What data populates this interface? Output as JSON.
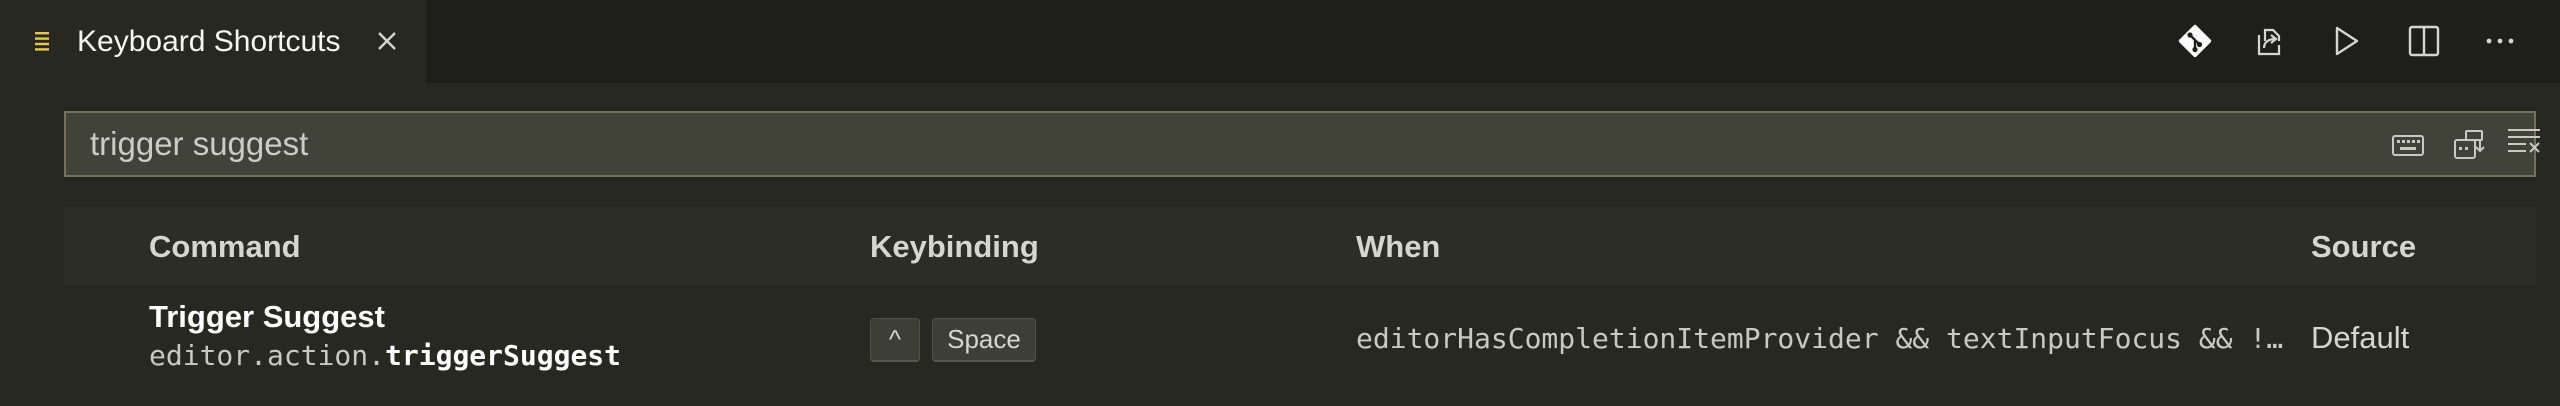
{
  "tab": {
    "title": "Keyboard Shortcuts",
    "icon": "list-icon",
    "close_icon": "close-icon"
  },
  "editor_actions": [
    {
      "name": "git-compare-icon"
    },
    {
      "name": "open-keybindings-json-icon"
    },
    {
      "name": "run-icon"
    },
    {
      "name": "split-editor-icon"
    },
    {
      "name": "more-actions-icon"
    }
  ],
  "search": {
    "value": "trigger suggest",
    "actions": [
      "record-keys-icon",
      "sort-by-precedence-icon",
      "clear-search-icon"
    ]
  },
  "table": {
    "headers": {
      "command": "Command",
      "keybinding": "Keybinding",
      "when": "When",
      "source": "Source"
    },
    "rows": [
      {
        "command": "Trigger Suggest",
        "command_id_prefix": "editor.action.",
        "command_id_match": "triggerSuggest",
        "keys": [
          "^",
          "Space"
        ],
        "when": "editorHasCompletionItemProvider && textInputFocus && !editorReadonly",
        "source": "Default"
      }
    ]
  },
  "colors": {
    "background": "#272822",
    "tabbar": "#1e1f1c",
    "input_background": "#414339",
    "input_border": "#75715e",
    "header_background": "#2c2d27",
    "tab_icon": "#e6c84c"
  }
}
